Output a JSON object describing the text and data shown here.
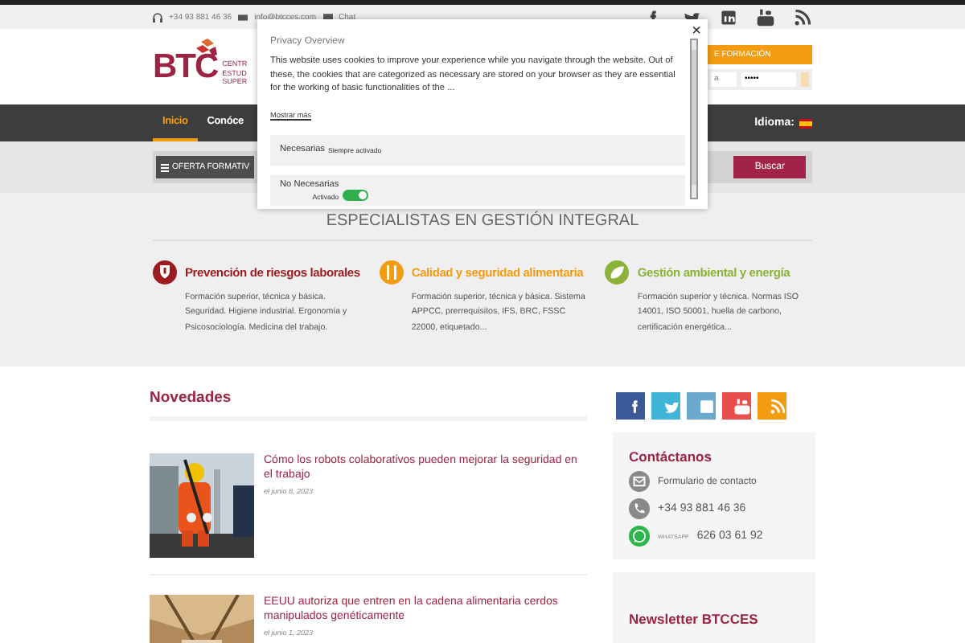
{
  "top_bar": {
    "phone": "+34 93 881 46 36",
    "email": "info@btcces.com",
    "chat": "Chat"
  },
  "header": {
    "logo": "BTC",
    "logo_lines": [
      "CENTR",
      "ESTUD",
      "SUPER"
    ],
    "login_banner": "E FORMACIÓN",
    "user_field": {
      "placeholder": "a"
    },
    "password_field": {
      "value": "•••••"
    }
  },
  "nav": {
    "items": [
      {
        "label": "Inicio",
        "selected": true
      },
      {
        "label": "Conóce",
        "selected": false
      }
    ],
    "language_label": "Idioma:"
  },
  "search_strip": {
    "catalog_button": "OFERTA FORMATIV",
    "search_button": "Buscar"
  },
  "cookie_dialog": {
    "close": "×",
    "title": "Privacy Overview",
    "text": "This website uses cookies to improve your experience while you navigate through the website. Out of these, the cookies that are categorized as necessary are stored on your browser as they are essential for the working of basic functionalities of the ...",
    "more_link": "Mostrar más",
    "categories": [
      {
        "kind": "always",
        "name": "Necesarias",
        "note": "Siempre activado"
      },
      {
        "kind": "toggle",
        "name": "No Necesarias",
        "note": "Activado",
        "on": true
      }
    ]
  },
  "specialties": {
    "heading": "ESPECIALISTAS EN GESTIÓN INTEGRAL",
    "items": [
      {
        "title": "Prevención de riesgos laborales",
        "color": "#9b1b1f",
        "text": "Formación superior, técnica y básica. Seguridad. Higiene industrial. Ergonomía y Psicosociología. Medicina del trabajo."
      },
      {
        "title": "Calidad y seguridad alimentaria",
        "color": "#f39c12",
        "text": "Formación superior, técnica y básica. Sistema APPCC, prerrequisitos, IFS, BRC, FSSC 22000, etiquetado..."
      },
      {
        "title": "Gestión ambiental y energía",
        "color": "#8cb23a",
        "text": "Formación superior y técnica. Normas ISO 14001, ISO 50001, huella de carbono, certificación energética..."
      }
    ]
  },
  "news": {
    "title": "Novedades",
    "articles": [
      {
        "title": "Cómo los robots colaborativos pueden mejorar la seguridad en el trabajo",
        "date": "el junio 8, 2023"
      },
      {
        "title": "EEUU autoriza que entren en la cadena alimentaria cerdos manipulados genéticamente",
        "date": "el junio 1, 2023"
      }
    ]
  },
  "sidebar": {
    "contact": {
      "title": "Contáctanos",
      "items": [
        {
          "kind": "form",
          "text": "Formulario de contacto"
        },
        {
          "kind": "phone",
          "text": "+34 93 881 46 36"
        },
        {
          "kind": "whatsapp",
          "label": "WHATSAPP",
          "text": "626 03 61 92"
        }
      ]
    },
    "newsletter": {
      "title": "Newsletter BTCCES"
    }
  }
}
